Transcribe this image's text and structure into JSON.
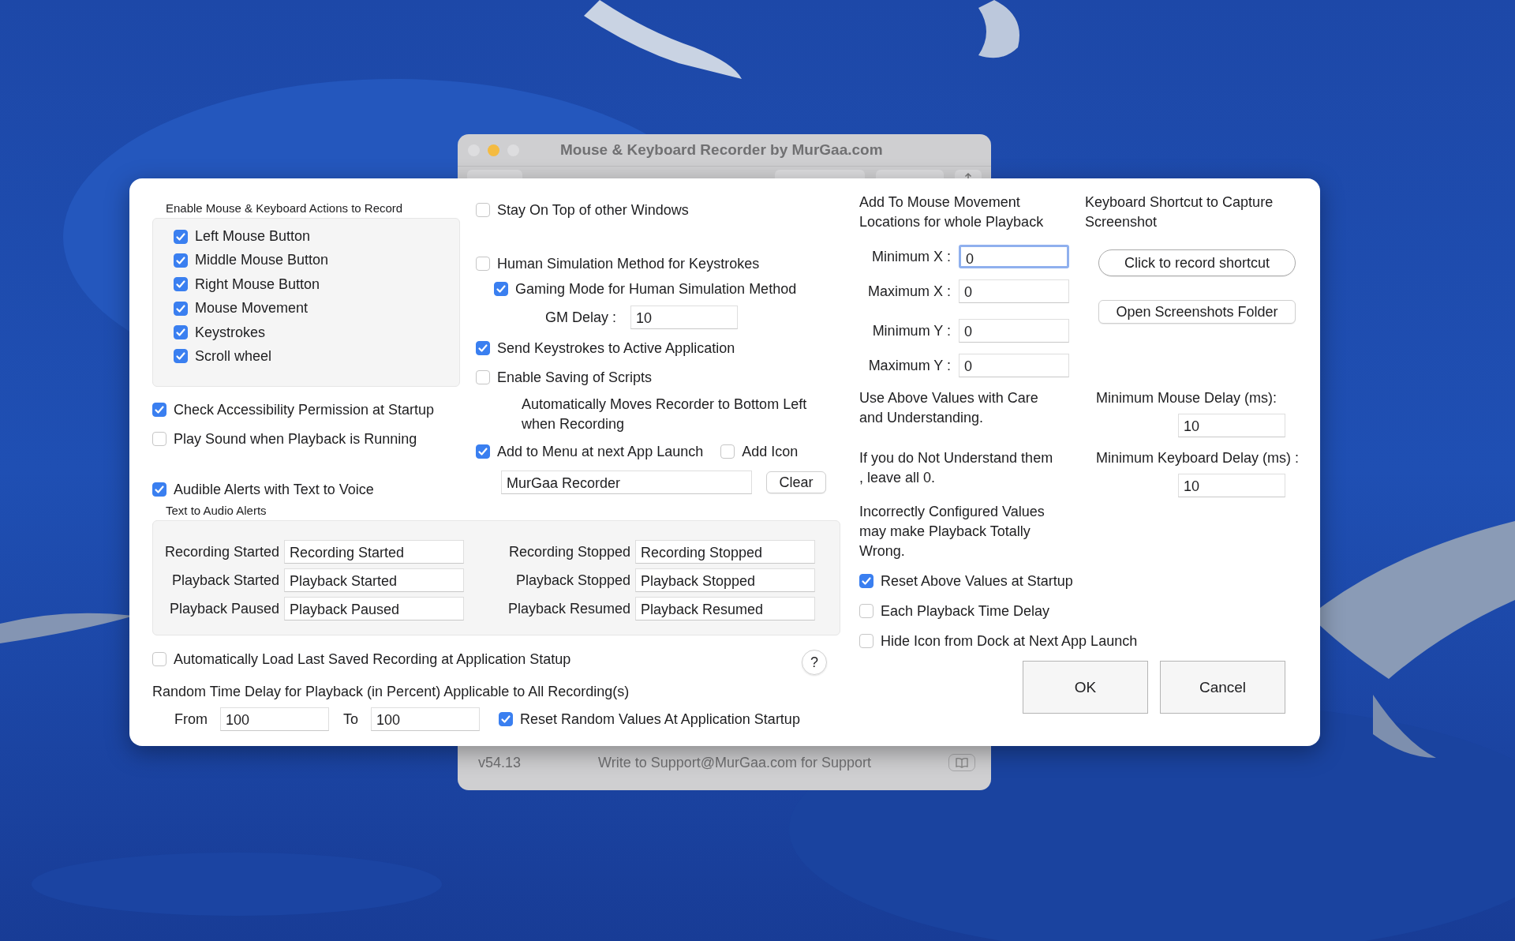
{
  "back_window": {
    "title": "Mouse & Keyboard Recorder by MurGaa.com",
    "lights": [
      {
        "color": "#dddddf"
      },
      {
        "color": "#f4bb41"
      },
      {
        "color": "#dddddf"
      }
    ],
    "version": "v54.13",
    "support_text": "Write to Support@MurGaa.com for Support"
  },
  "record_actions": {
    "title": "Enable Mouse & Keyboard Actions to Record",
    "items": [
      {
        "label": "Left Mouse Button",
        "checked": true
      },
      {
        "label": "Middle Mouse Button",
        "checked": true
      },
      {
        "label": "Right Mouse Button",
        "checked": true
      },
      {
        "label": "Mouse Movement",
        "checked": true
      },
      {
        "label": "Keystrokes",
        "checked": true
      },
      {
        "label": "Scroll wheel",
        "checked": true
      }
    ]
  },
  "left_options": [
    {
      "label": "Check Accessibility Permission at Startup",
      "checked": true
    },
    {
      "label": "Play Sound when Playback is Running",
      "checked": false
    }
  ],
  "audible_alerts": {
    "label": "Audible Alerts with Text to Voice",
    "checked": true
  },
  "stay_on_top": {
    "label": "Stay On Top of other Windows",
    "checked": false
  },
  "human_simulation": {
    "label": "Human Simulation Method for Keystrokes",
    "checked": false
  },
  "gaming_mode": {
    "label": "Gaming Mode for Human Simulation Method",
    "checked": true
  },
  "gm_delay": {
    "label": "GM Delay :",
    "value": "10"
  },
  "send_keystrokes": {
    "label": "Send Keystrokes to Active Application",
    "checked": true
  },
  "enable_saving": {
    "label": "Enable Saving of Scripts",
    "checked": false
  },
  "auto_move_note": "Automatically Moves Recorder to Bottom Left when Recording",
  "add_to_menu": {
    "label": "Add to Menu at next App Launch",
    "checked": true
  },
  "add_icon": {
    "label": "Add Icon",
    "checked": false
  },
  "menu_name": {
    "value": "MurGaa Recorder"
  },
  "clear_button": "Clear",
  "text_to_audio": {
    "title": "Text to Audio Alerts",
    "fields": [
      {
        "label": "Recording Started",
        "value": "Recording Started"
      },
      {
        "label": "Recording Stopped",
        "value": "Recording Stopped"
      },
      {
        "label": "Playback Started",
        "value": "Playback Started"
      },
      {
        "label": "Playback Stopped",
        "value": "Playback Stopped"
      },
      {
        "label": "Playback Paused",
        "value": "Playback Paused"
      },
      {
        "label": "Playback Resumed",
        "value": "Playback Resumed"
      }
    ]
  },
  "auto_load": {
    "label": "Automatically Load Last Saved Recording at Application Statup",
    "checked": false
  },
  "help_button": "?",
  "random_delay": {
    "title": "Random Time Delay for Playback (in Percent) Applicable to All Recording(s)",
    "from_label": "From",
    "from_value": "100",
    "to_label": "To",
    "to_value": "100",
    "reset": {
      "label": "Reset Random Values At Application Startup",
      "checked": true
    }
  },
  "locations": {
    "title": "Add To Mouse Movement Locations for whole Playback",
    "fields": [
      {
        "label": "Minimum X :",
        "value": "0",
        "focused": true
      },
      {
        "label": "Maximum X :",
        "value": "0",
        "focused": false
      },
      {
        "label": "Minimum Y :",
        "value": "0",
        "focused": false
      },
      {
        "label": "Maximum Y :",
        "value": "0",
        "focused": false
      }
    ]
  },
  "screenshot": {
    "title": "Keyboard Shortcut to Capture Screenshot",
    "record_button": "Click to record shortcut",
    "open_button": "Open Screenshots Folder"
  },
  "notes": [
    "Use Above Values with Care and Understanding.",
    "If you do Not Understand them , leave all 0.",
    "Incorrectly Configured Values may make Playback Totally Wrong."
  ],
  "delays": [
    {
      "label": "Minimum Mouse Delay (ms):",
      "value": "10"
    },
    {
      "label": "Minimum Keyboard Delay (ms) :",
      "value": "10"
    }
  ],
  "right_options": [
    {
      "label": "Reset Above Values at Startup",
      "checked": true
    },
    {
      "label": "Each Playback Time Delay",
      "checked": false
    },
    {
      "label": "Hide Icon from Dock at Next App Launch",
      "checked": false
    }
  ],
  "buttons": [
    "OK",
    "Cancel"
  ]
}
